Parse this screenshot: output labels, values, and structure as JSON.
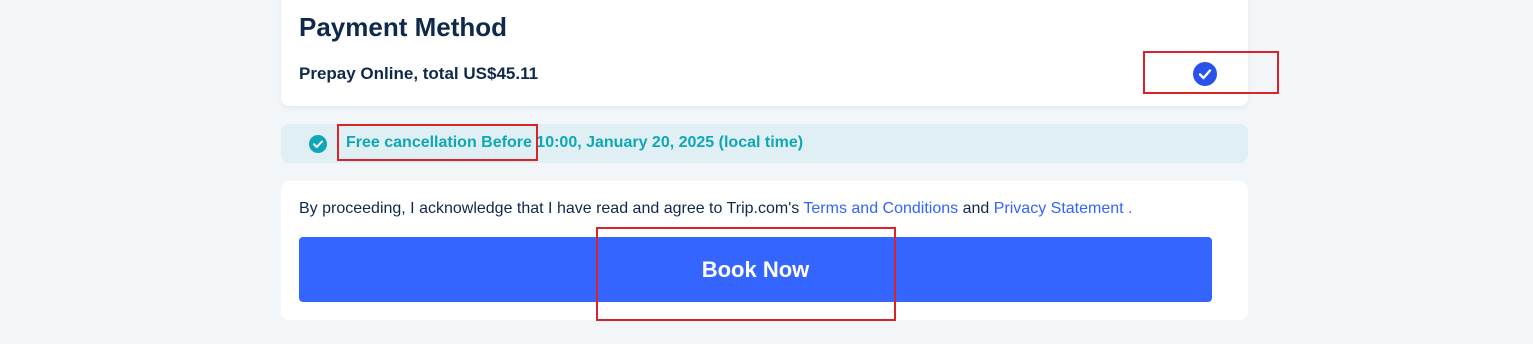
{
  "payment": {
    "title": "Payment Method",
    "option_label": "Prepay Online, total US$45.11",
    "selected": true
  },
  "cancellation": {
    "text": "Free cancellation Before 10:00, January 20, 2025 (local time)"
  },
  "terms": {
    "prefix": "By proceeding, I acknowledge that I have read and agree to Trip.com's ",
    "terms_link": "Terms and Conditions",
    "conjunction": " and ",
    "privacy_link": "Privacy Statement ."
  },
  "actions": {
    "book_label": "Book Now"
  },
  "colors": {
    "accent": "#3565ff",
    "teal": "#0fa7b5",
    "highlight": "#d9222a",
    "title": "#0f294d"
  },
  "icons": {
    "selected_check": "check-circle-icon",
    "cancellation_check": "check-circle-icon"
  }
}
